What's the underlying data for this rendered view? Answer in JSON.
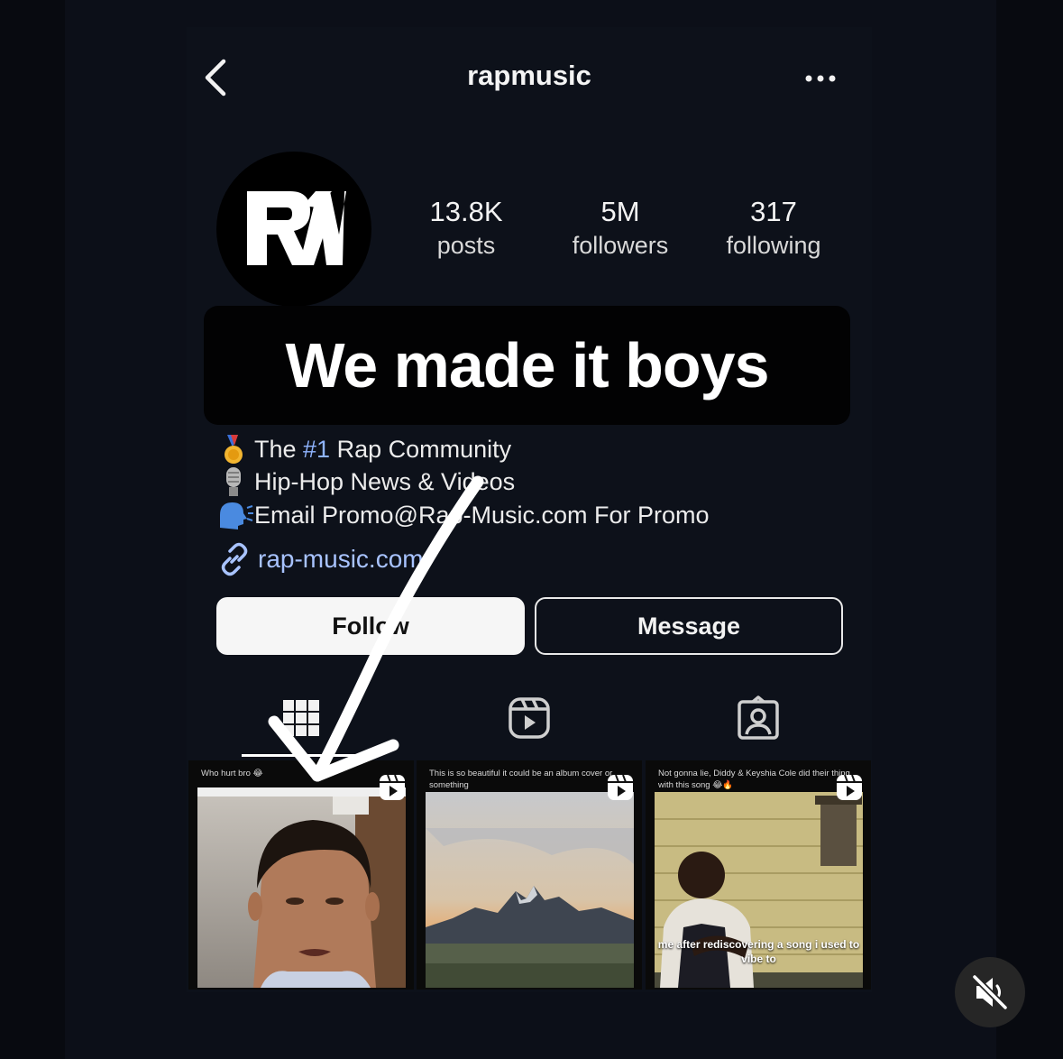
{
  "profile": {
    "username": "rapmusic",
    "avatar_initials": "RM",
    "stats": [
      {
        "value": "13.8K",
        "label": "posts"
      },
      {
        "value": "5M",
        "label": "followers"
      },
      {
        "value": "317",
        "label": "following"
      }
    ],
    "bio": {
      "line1_prefix": "The ",
      "line1_hashtag": "#1",
      "line1_suffix": " Rap Community",
      "line2": "Hip-Hop News & Videos",
      "line3": "Email Promo@Rap-Music.com For Promo"
    },
    "link": "rap-music.com"
  },
  "overlay_text": "We made it boys",
  "buttons": {
    "follow": "Follow",
    "message": "Message"
  },
  "tabs": [
    "posts-grid",
    "reels",
    "tagged"
  ],
  "posts": [
    {
      "caption": "Who hurt bro 😂",
      "subtitle": ""
    },
    {
      "caption": "This is so beautiful it could be an album cover or something",
      "subtitle": ""
    },
    {
      "caption": "Not gonna lie, Diddy & Keyshia Cole did their thing with this song 😂🔥",
      "subtitle": "me after rediscovering a song i used to vibe to"
    }
  ],
  "icons": {
    "back": "chevron-left-icon",
    "more": "more-horizontal-icon",
    "link": "link-icon",
    "mute": "speaker-muted-icon",
    "reel": "reel-icon"
  },
  "colors": {
    "background": "#0d111a",
    "link": "#a8c3ff",
    "hashtag": "#8fb4ff"
  }
}
